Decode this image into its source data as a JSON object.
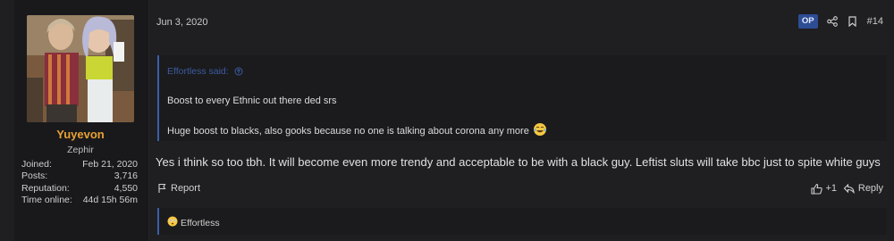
{
  "user": {
    "name": "Yuyevon",
    "title": "Zephir",
    "stats": [
      {
        "label": "Joined:",
        "value": "Feb 21, 2020"
      },
      {
        "label": "Posts:",
        "value": "3,716"
      },
      {
        "label": "Reputation:",
        "value": "4,550"
      },
      {
        "label": "Time online:",
        "value": "44d 15h 56m"
      }
    ]
  },
  "post": {
    "date": "Jun 3, 2020",
    "op_badge": "OP",
    "number": "#14",
    "quote": {
      "author": "Effortless said:",
      "line1": "Boost to every Ethnic out there ded srs",
      "line2": "Huge boost to blacks, also gooks because no one is talking about corona any more"
    },
    "body": "Yes i think so too tbh. It will become even more trendy and acceptable to be with a black guy. Leftist sluts will take bbc just to spite white guys",
    "report_label": "Report",
    "likes_label": "+1",
    "reply_label": "Reply",
    "reactor": "Effortless"
  },
  "colors": {
    "accent": "#e8a136",
    "quote_border": "#3b5fa8",
    "op_badge_bg": "#2d4d95"
  },
  "icons": [
    "share-icon",
    "bookmark-icon",
    "flag-icon",
    "like-icon",
    "reply-icon",
    "laugh-cry-emoji",
    "flushed-emoji"
  ]
}
